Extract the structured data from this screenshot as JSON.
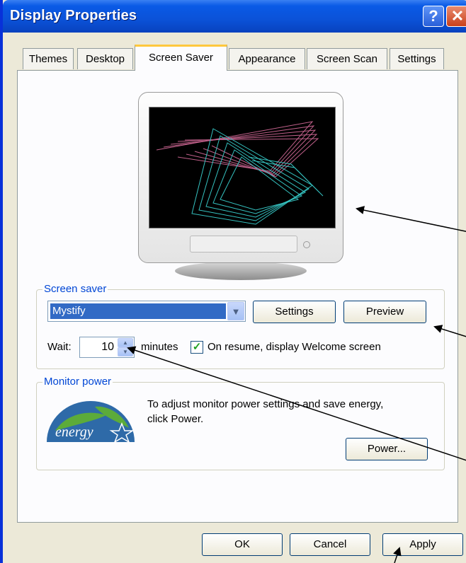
{
  "window": {
    "title": "Display Properties",
    "help_label": "?",
    "close_label": "✕"
  },
  "tabs": [
    {
      "label": "Themes"
    },
    {
      "label": "Desktop"
    },
    {
      "label": "Screen Saver"
    },
    {
      "label": "Appearance"
    },
    {
      "label": "Screen Scan"
    },
    {
      "label": "Settings"
    }
  ],
  "screensaver": {
    "group_label": "Screen saver",
    "selected": "Mystify",
    "settings_button": "Settings",
    "preview_button": "Preview",
    "wait_label": "Wait:",
    "wait_value": "10",
    "minutes_label": "minutes",
    "resume_checkbox_label": "On resume, display Welcome screen",
    "resume_checked": true
  },
  "monitor_power": {
    "group_label": "Monitor power",
    "description_line1": "To adjust monitor power settings and save energy,",
    "description_line2": "click Power.",
    "power_button": "Power...",
    "logo_text": "energy"
  },
  "footer": {
    "ok_button": "OK",
    "cancel_button": "Cancel",
    "apply_button": "Apply"
  },
  "colors": {
    "titlebar": "#0a5ae6",
    "group_label": "#0046d5",
    "selection": "#316ac5",
    "active_tab_accent": "#ffc83c"
  }
}
